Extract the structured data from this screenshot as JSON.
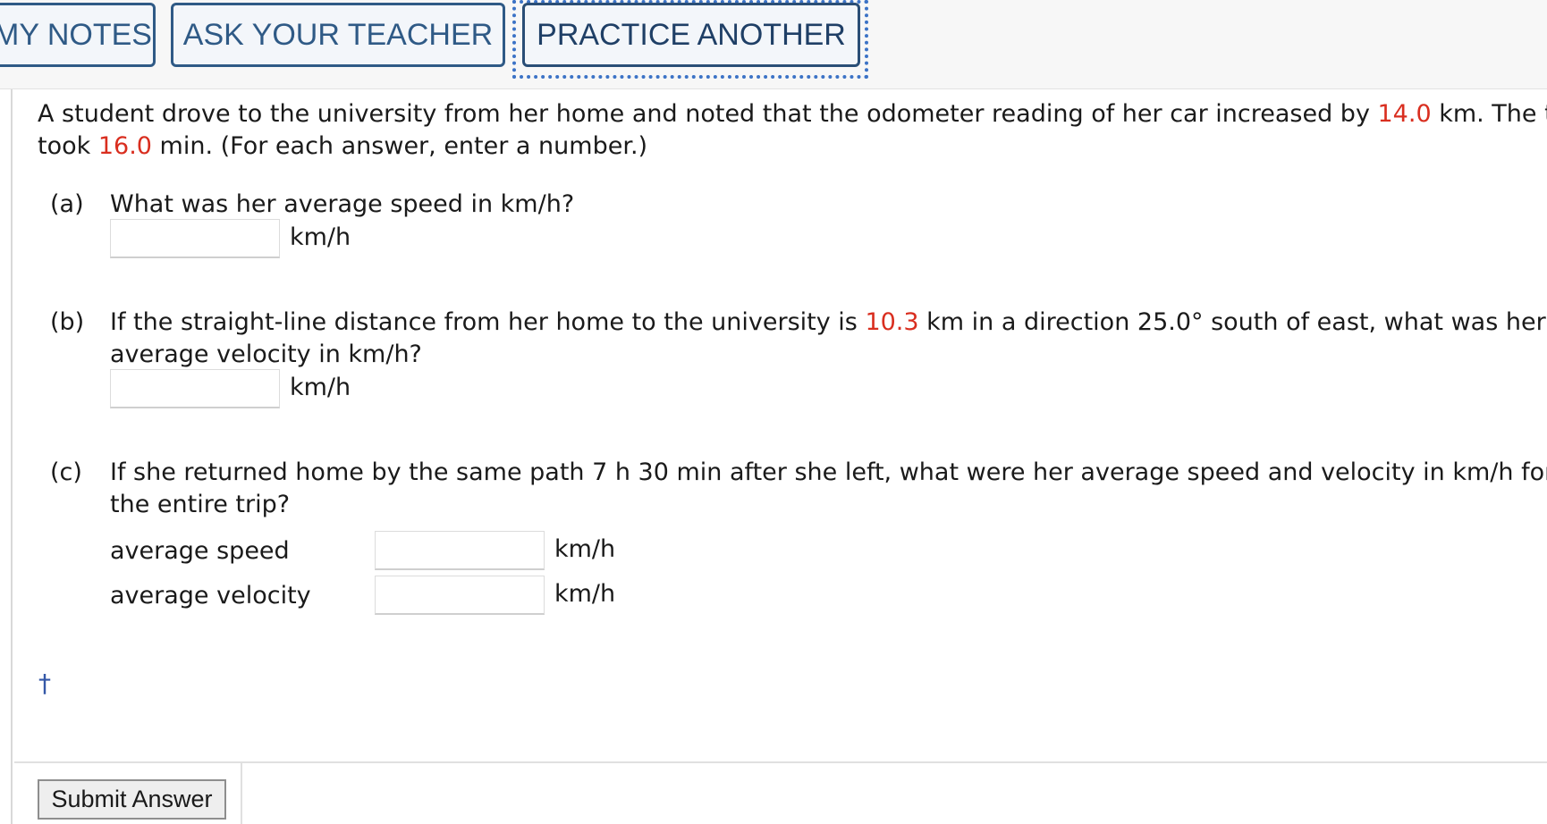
{
  "toolbar": {
    "my_notes": "MY NOTES",
    "ask_teacher": "ASK YOUR TEACHER",
    "practice_another": "PRACTICE ANOTHER"
  },
  "problem": {
    "intro_1": "A student drove to the university from her home and noted that the odometer reading of her car increased by ",
    "distance": "14.0",
    "intro_2": " km. The trip",
    "intro_3": "took ",
    "time": "16.0",
    "intro_4": " min. (For each answer, enter a number.)"
  },
  "part_a": {
    "label": "(a)",
    "question": "What was her average speed in km/h?",
    "unit": "km/h"
  },
  "part_b": {
    "label": "(b)",
    "question_1": "If the straight-line distance from her home to the university is ",
    "displacement": "10.3",
    "question_2": " km in a direction 25.0° south of east, what was her",
    "question_3": "average velocity in km/h?",
    "unit": "km/h"
  },
  "part_c": {
    "label": "(c)",
    "question_1": "If she returned home by the same path 7 h 30 min after she left, what were her average speed and velocity in km/h for",
    "question_2": "the entire trip?",
    "speed_label": "average speed",
    "velocity_label": "average velocity",
    "unit_speed": "km/h",
    "unit_velocity": "km/h"
  },
  "footnote": {
    "dagger": "†"
  },
  "submit": {
    "label": "Submit Answer"
  },
  "colors": {
    "accent": "#2f5a86",
    "highlight": "#d92e1f"
  }
}
